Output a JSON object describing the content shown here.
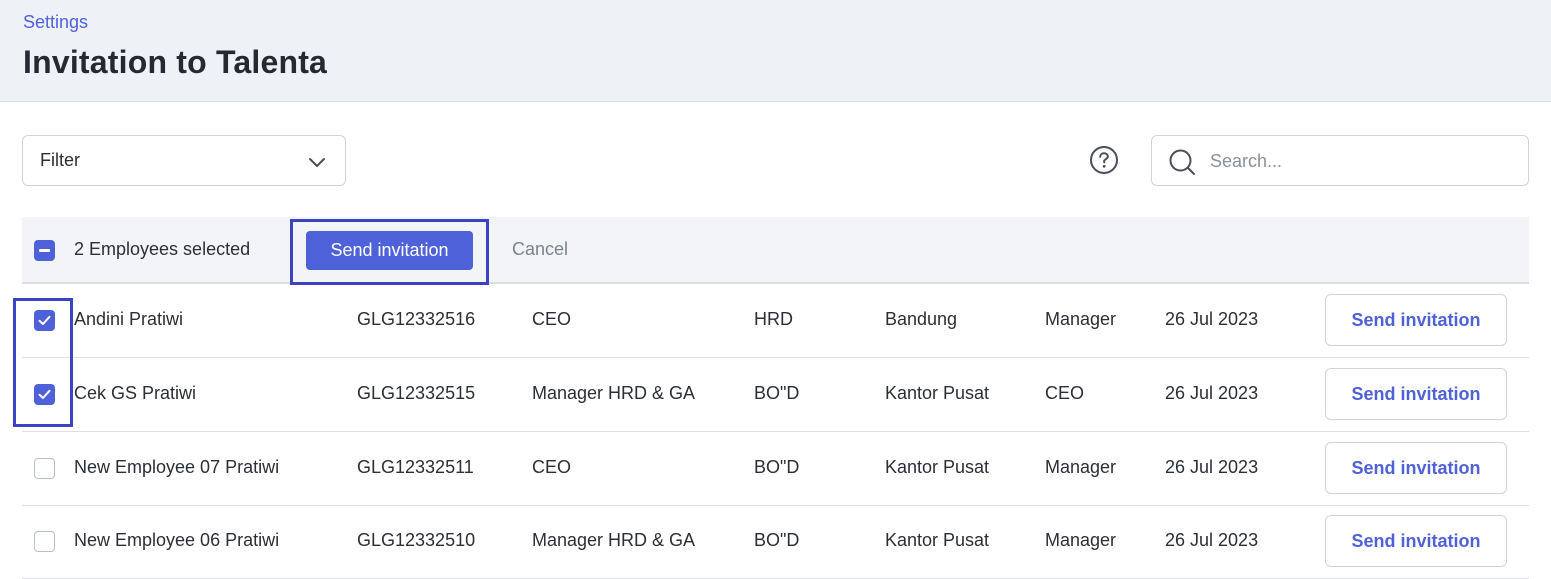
{
  "header": {
    "breadcrumb": "Settings",
    "title": "Invitation to Talenta"
  },
  "toolbar": {
    "filter_label": "Filter",
    "search_placeholder": "Search..."
  },
  "bulk": {
    "selected_text": "2 Employees selected",
    "send_label": "Send invitation",
    "cancel_label": "Cancel"
  },
  "rows": [
    {
      "checked": true,
      "name": "Andini Pratiwi",
      "id": "GLG12332516",
      "job": "CEO",
      "org": "HRD",
      "branch": "Bandung",
      "level": "Manager",
      "date": "26 Jul 2023",
      "action": "Send invitation"
    },
    {
      "checked": true,
      "name": "Cek GS Pratiwi",
      "id": "GLG12332515",
      "job": "Manager HRD & GA",
      "org": "BO\"D",
      "branch": "Kantor Pusat",
      "level": "CEO",
      "date": "26 Jul 2023",
      "action": "Send invitation"
    },
    {
      "checked": false,
      "name": "New Employee 07 Pratiwi",
      "id": "GLG12332511",
      "job": "CEO",
      "org": "BO\"D",
      "branch": "Kantor Pusat",
      "level": "Manager",
      "date": "26 Jul 2023",
      "action": "Send invitation"
    },
    {
      "checked": false,
      "name": "New Employee 06 Pratiwi",
      "id": "GLG12332510",
      "job": "Manager HRD & GA",
      "org": "BO\"D",
      "branch": "Kantor Pusat",
      "level": "Manager",
      "date": "26 Jul 2023",
      "action": "Send invitation"
    }
  ],
  "colors": {
    "accent": "#4f61d8",
    "highlight": "#3c44c4",
    "header_bg": "#eef2f7"
  }
}
